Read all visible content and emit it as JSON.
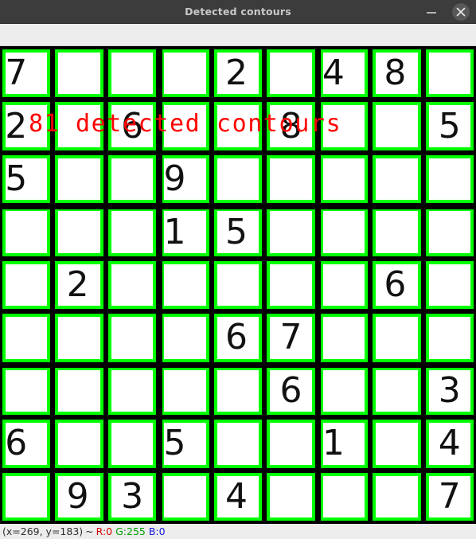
{
  "window": {
    "title": "Detected contours",
    "minimize_label": "–",
    "close_label": "×"
  },
  "overlay": {
    "text": "81 detected contours",
    "color": "#ff0000",
    "contour_count": 81
  },
  "canvas": {
    "background": "#000000",
    "contour_color": "#00ff00",
    "cell_fill": "#ffffff",
    "digit_color": "#111111"
  },
  "statusbar": {
    "coords": "(x=269, y=183)",
    "separator": "~",
    "r_label": "R:0",
    "g_label": "G:255",
    "b_label": "B:0",
    "r_color": "#d40000",
    "g_color": "#00a000",
    "b_color": "#1515e0"
  },
  "sudoku": {
    "rows": 9,
    "cols": 9,
    "cells": [
      [
        "7",
        "",
        "",
        "",
        "2",
        "",
        "4",
        "8",
        ""
      ],
      [
        "2",
        "",
        "6",
        "",
        "",
        "8",
        "",
        "",
        "5"
      ],
      [
        "5",
        "",
        "",
        "9",
        "",
        "",
        "",
        "",
        ""
      ],
      [
        "",
        "",
        "",
        "1",
        "5",
        "",
        "",
        "",
        ""
      ],
      [
        "",
        "2",
        "",
        "",
        "",
        "",
        "",
        "6",
        ""
      ],
      [
        "",
        "",
        "",
        "",
        "6",
        "7",
        "",
        "",
        ""
      ],
      [
        "",
        "",
        "",
        "",
        "",
        "6",
        "",
        "",
        "3"
      ],
      [
        "6",
        "",
        "",
        "5",
        "",
        "",
        "1",
        "",
        "4"
      ],
      [
        "",
        "9",
        "3",
        "",
        "4",
        "",
        "",
        "",
        "7"
      ]
    ]
  }
}
